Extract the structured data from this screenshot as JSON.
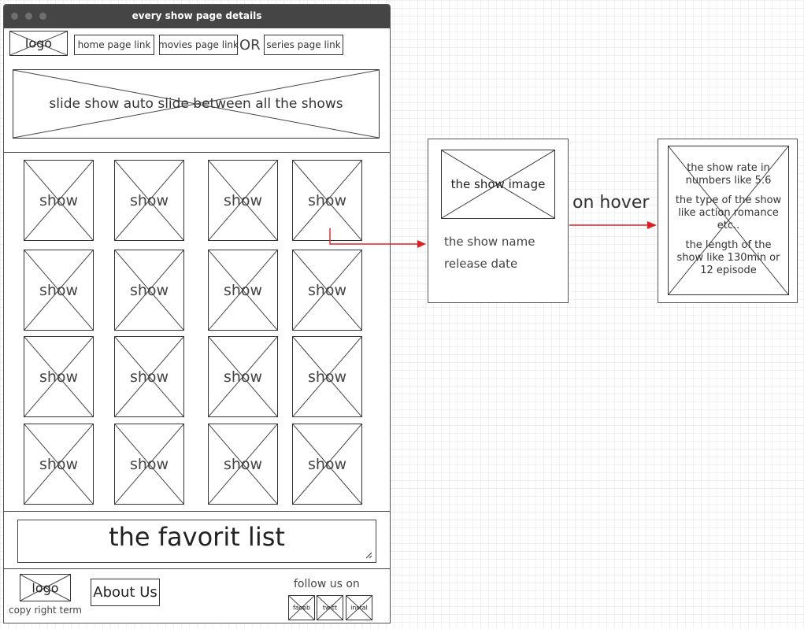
{
  "window": {
    "title": "every show page details"
  },
  "header": {
    "logo": "logo",
    "home_link": "home page link",
    "movies_link": "movies page link",
    "or": "OR",
    "series_link": "series page link"
  },
  "slideshow": {
    "label": "slide show auto slide between all the shows"
  },
  "grid": {
    "items": [
      "show",
      "show",
      "show",
      "show",
      "show",
      "show",
      "show",
      "show",
      "show",
      "show",
      "show",
      "show",
      "show",
      "show",
      "show",
      "show"
    ]
  },
  "favorites": {
    "label": "the favorit list"
  },
  "footer": {
    "logo": "logo",
    "copyright": "copy right term",
    "about": "About Us",
    "follow": "follow us on",
    "social": [
      "faceb",
      "twitt",
      "instal"
    ]
  },
  "card": {
    "image": "the show image",
    "name": "the show name",
    "release": "release date"
  },
  "hover_label": "on hover",
  "details": {
    "rate": "the show rate in numbers like 5.6",
    "type": "the type of the show like action romance etc..",
    "length": "the length of the show like 130min or 12 episode"
  },
  "colors": {
    "arrow": "#e02020",
    "titlebar": "#454545"
  }
}
